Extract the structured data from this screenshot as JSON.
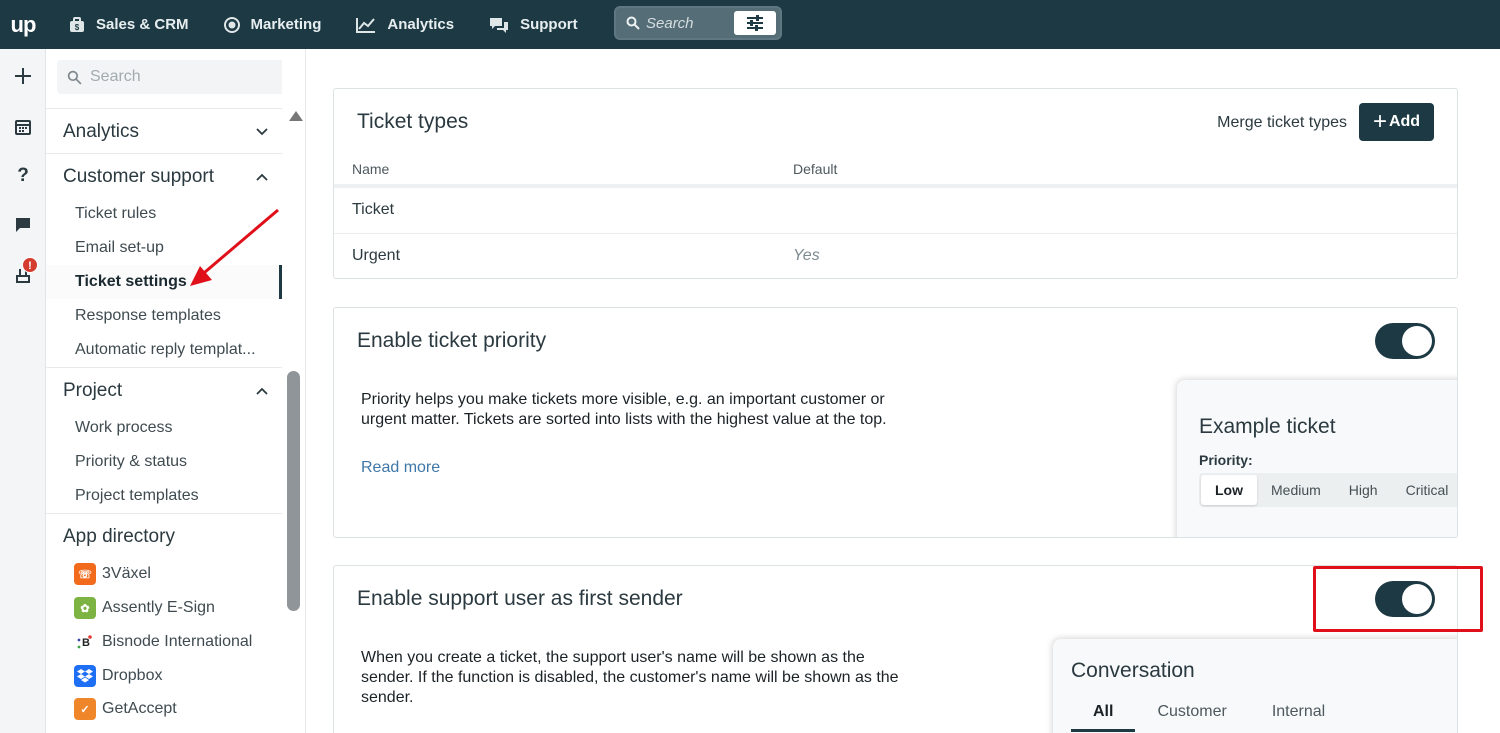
{
  "topbar": {
    "logo": "up",
    "nav": [
      {
        "label": "Sales & CRM",
        "icon": "briefcase-icon"
      },
      {
        "label": "Marketing",
        "icon": "target-icon"
      },
      {
        "label": "Analytics",
        "icon": "chart-line-icon"
      },
      {
        "label": "Support",
        "icon": "chat-bubbles-icon"
      }
    ],
    "search_placeholder": "Search"
  },
  "sidebar": {
    "search_placeholder": "Search",
    "sections": {
      "analytics": "Analytics",
      "customer_support": "Customer support",
      "project": "Project",
      "app_directory": "App directory"
    },
    "customer_support_items": [
      "Ticket rules",
      "Email set-up",
      "Ticket settings",
      "Response templates",
      "Automatic reply templat..."
    ],
    "project_items": [
      "Work process",
      "Priority & status",
      "Project templates"
    ],
    "apps": [
      {
        "label": "3Växel",
        "color": "#f26b1d"
      },
      {
        "label": "Assently E-Sign",
        "color": "#7cb342"
      },
      {
        "label": "Bisnode International",
        "color": "#ffffff"
      },
      {
        "label": "Dropbox",
        "color": "#1f6ff5"
      },
      {
        "label": "GetAccept",
        "color": "#f0862a"
      }
    ],
    "rail_badge": "!"
  },
  "ticket_types": {
    "title": "Ticket types",
    "merge_label": "Merge ticket types",
    "add_label": "Add",
    "col_name": "Name",
    "col_default": "Default",
    "rows": [
      {
        "name": "Ticket",
        "default": ""
      },
      {
        "name": "Urgent",
        "default": "Yes"
      }
    ]
  },
  "priority": {
    "title": "Enable ticket priority",
    "enabled": true,
    "description": "Priority helps you make tickets more visible, e.g. an important customer or urgent matter. Tickets are sorted into lists with the highest value at the top.",
    "read_more": "Read more",
    "example_title": "Example ticket",
    "priority_label": "Priority:",
    "levels": [
      "Low",
      "Medium",
      "High",
      "Critical"
    ],
    "selected_level": "Low"
  },
  "first_sender": {
    "title": "Enable support user as first sender",
    "enabled": true,
    "description": "When you create a ticket, the support user's name will be shown as the sender. If the function is disabled, the customer's name will be shown as the sender.",
    "preview_title": "Conversation",
    "tabs": [
      "All",
      "Customer",
      "Internal"
    ]
  },
  "colors": {
    "topbar": "#1d3a44",
    "accent": "#1d3a44",
    "highlight": "#e0101a",
    "link": "#3e77a8"
  }
}
